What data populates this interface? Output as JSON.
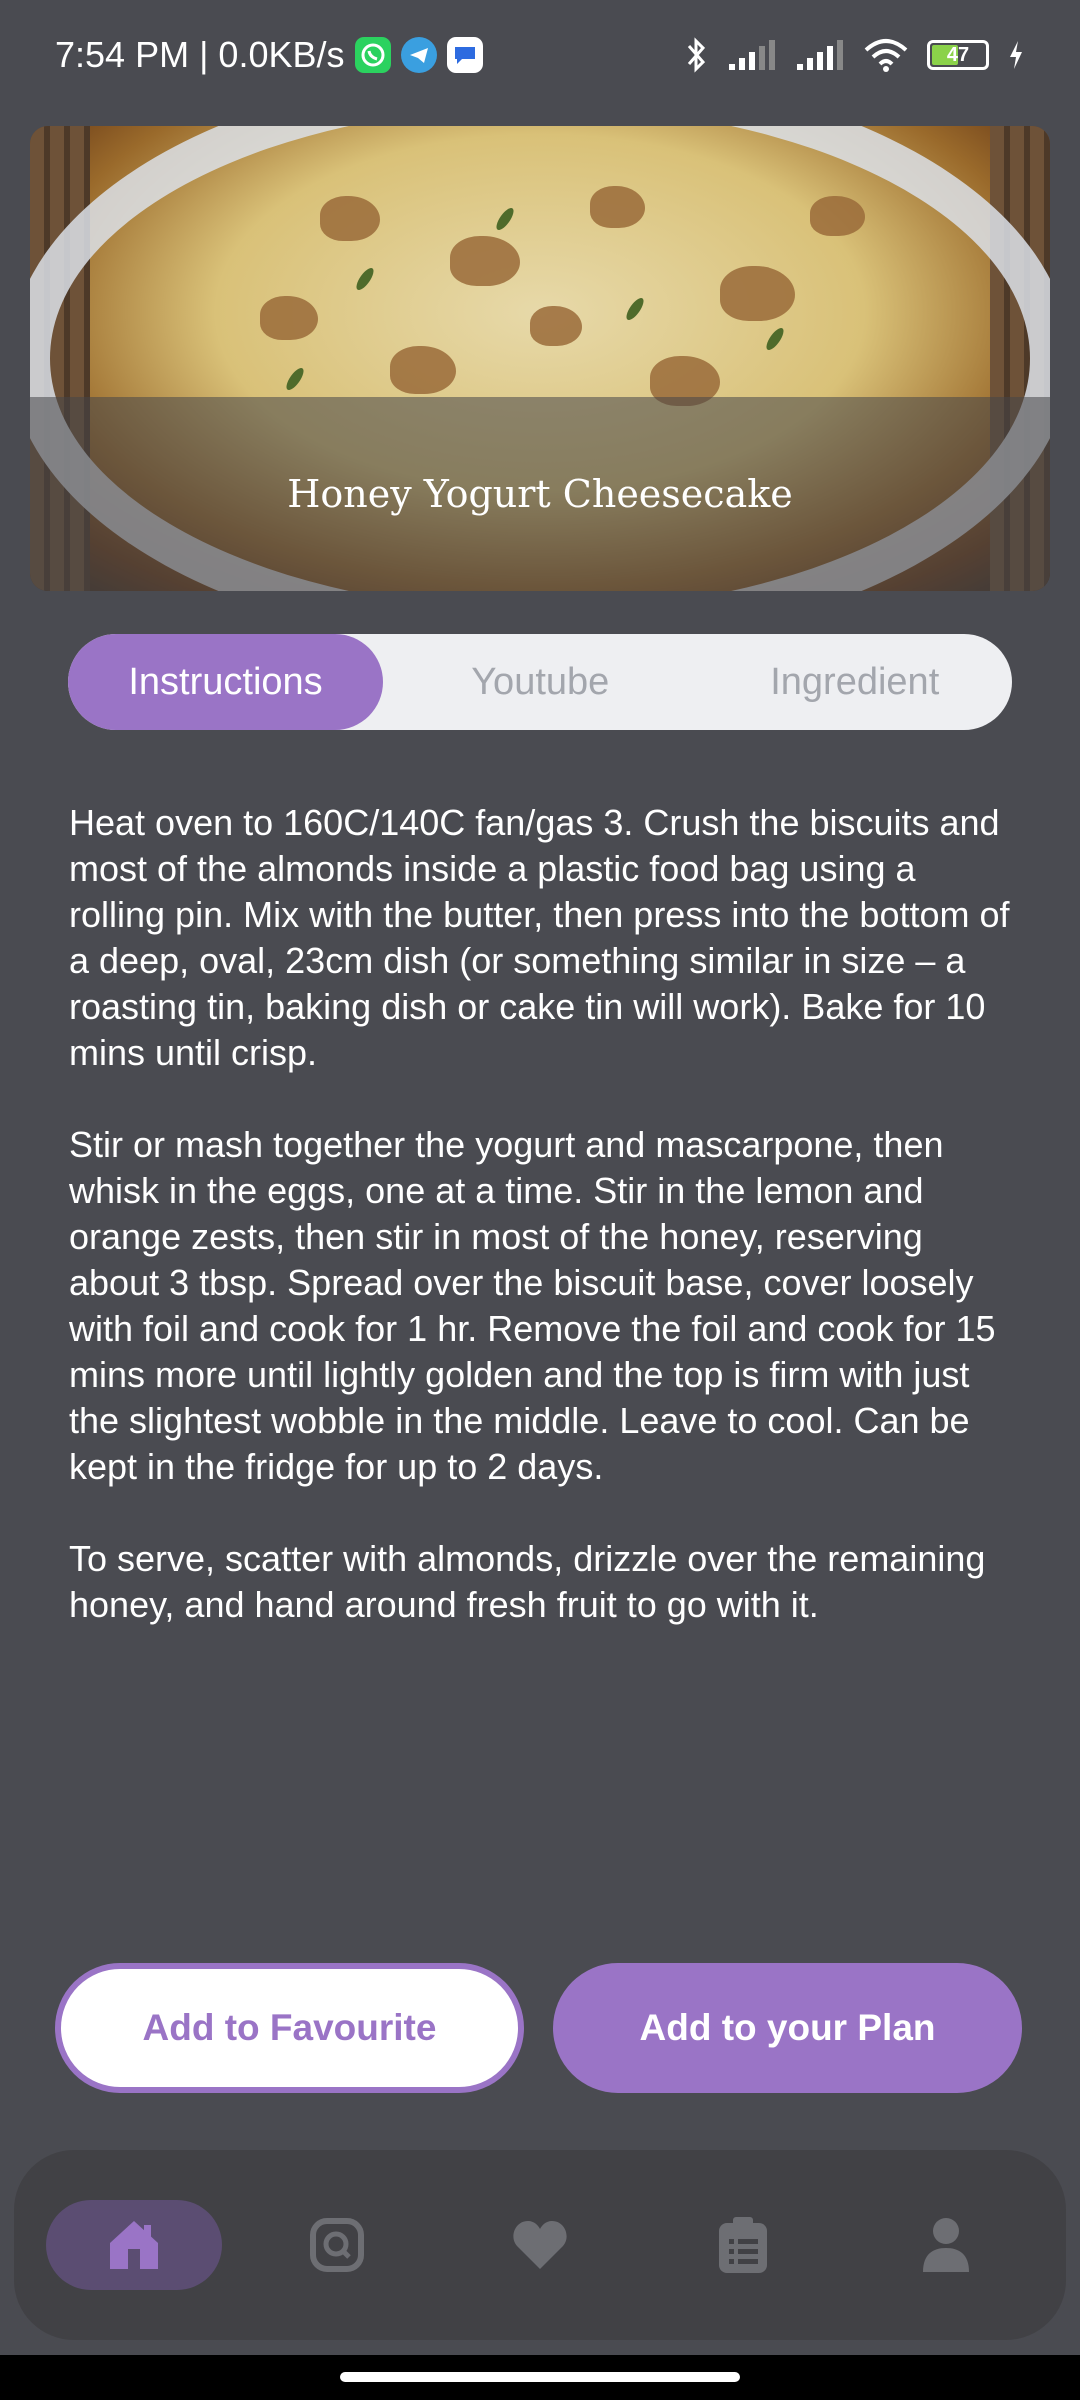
{
  "status_bar": {
    "time_text": "7:54 PM | 0.0KB/s",
    "battery_level": "47"
  },
  "recipe": {
    "title": "Honey Yogurt Cheesecake"
  },
  "tabs": [
    {
      "label": "Instructions",
      "active": true
    },
    {
      "label": "Youtube",
      "active": false
    },
    {
      "label": "Ingredient",
      "active": false
    }
  ],
  "instructions": {
    "paragraphs": [
      "Heat oven to 160C/140C fan/gas 3. Crush the biscuits and most of the almonds inside a plastic food bag using a rolling pin. Mix with the butter, then press into the bottom of a deep, oval, 23cm dish (or something similar in size – a roasting tin, baking dish or cake tin will work). Bake for 10 mins until crisp.",
      "Stir or mash together the yogurt and mascarpone, then whisk in the eggs, one at a time. Stir in the lemon and orange zests, then stir in most of the honey, reserving about 3 tbsp. Spread over the biscuit base, cover loosely with foil and cook for 1 hr. Remove the foil and cook for 15 mins more until lightly golden and the top is firm with just the slightest wobble in the middle. Leave to cool. Can be kept in the fridge for up to 2 days.",
      "To serve, scatter with almonds, drizzle over the remaining honey, and hand around fresh fruit to go with it."
    ]
  },
  "actions": {
    "favourite_label": "Add to Favourite",
    "plan_label": "Add to your Plan"
  },
  "nav": {
    "items": [
      "home-icon",
      "search-icon",
      "heart-icon",
      "clipboard-icon",
      "person-icon"
    ],
    "active_index": 0
  },
  "colors": {
    "accent": "#9a74c6",
    "background": "#4a4b51",
    "nav_background": "#414145"
  }
}
